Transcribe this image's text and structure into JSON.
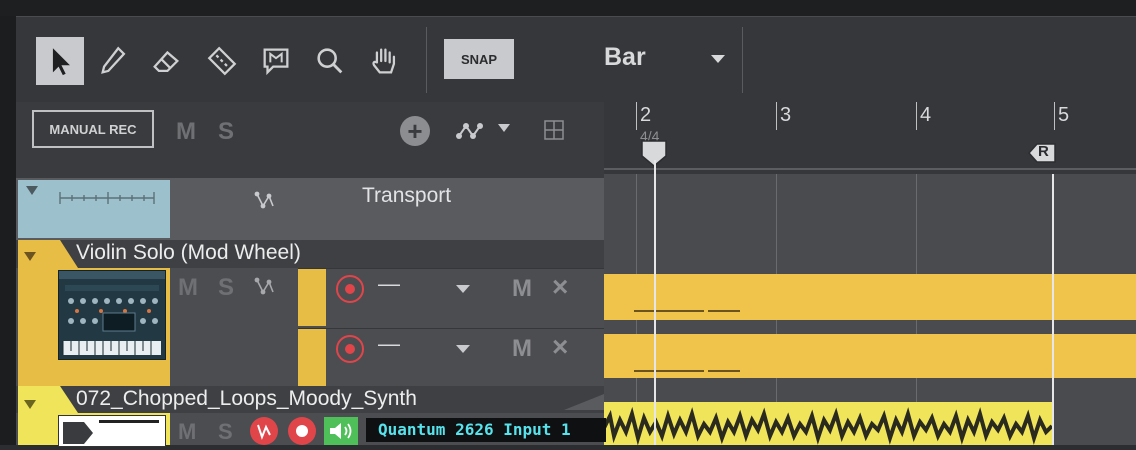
{
  "toolbar": {
    "tools": [
      {
        "name": "arrow-tool",
        "active": true
      },
      {
        "name": "pencil-tool",
        "active": false
      },
      {
        "name": "eraser-tool",
        "active": false
      },
      {
        "name": "split-tool",
        "active": false
      },
      {
        "name": "marker-tool",
        "active": false
      },
      {
        "name": "zoom-tool",
        "active": false
      },
      {
        "name": "hand-tool",
        "active": false
      }
    ],
    "snap_label": "SNAP",
    "snap_value": "Bar"
  },
  "track_header": {
    "manual_rec_label": "MANUAL REC",
    "mute_label": "M",
    "solo_label": "S"
  },
  "ruler": {
    "bars": [
      "2",
      "3",
      "4",
      "5"
    ],
    "time_signature": "4/4",
    "marker_label": "R"
  },
  "tracks": [
    {
      "name": "Transport",
      "color": "#9cc1cc"
    },
    {
      "name": "Violin Solo (Mod Wheel)",
      "color": "#e8bd45",
      "mute_label": "M",
      "solo_label": "S",
      "lanes": [
        {
          "value": "—",
          "mute_label": "M",
          "close_label": "×"
        },
        {
          "value": "—",
          "mute_label": "M",
          "close_label": "×"
        }
      ]
    },
    {
      "name": "072_Chopped_Loops_Moody_Synth",
      "color": "#f0e45a",
      "mute_label": "M",
      "solo_label": "S",
      "input": "Quantum 2626 Input 1"
    }
  ]
}
